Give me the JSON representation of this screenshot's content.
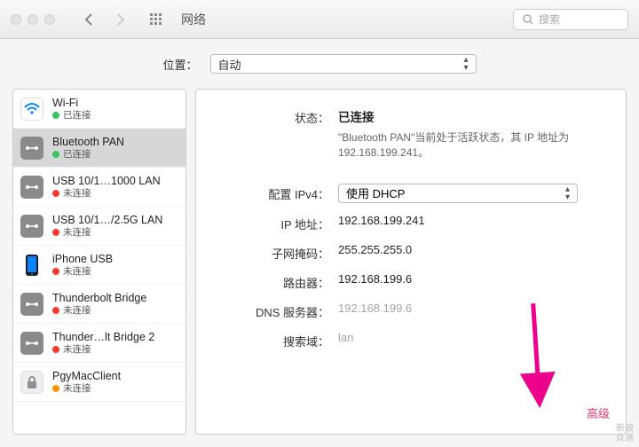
{
  "titlebar": {
    "title": "网络",
    "search_placeholder": "搜索"
  },
  "location": {
    "label": "位置：",
    "value": "自动"
  },
  "sidebar": {
    "items": [
      {
        "name": "Wi-Fi",
        "status": "已连接",
        "color": "green",
        "icon": "wifi"
      },
      {
        "name": "Bluetooth PAN",
        "status": "已连接",
        "color": "green",
        "icon": "eth"
      },
      {
        "name": "USB 10/1…1000 LAN",
        "status": "未连接",
        "color": "red",
        "icon": "eth"
      },
      {
        "name": "USB 10/1…/2.5G LAN",
        "status": "未连接",
        "color": "red",
        "icon": "eth"
      },
      {
        "name": "iPhone USB",
        "status": "未连接",
        "color": "red",
        "icon": "phone"
      },
      {
        "name": "Thunderbolt Bridge",
        "status": "未连接",
        "color": "red",
        "icon": "eth"
      },
      {
        "name": "Thunder…lt Bridge 2",
        "status": "未连接",
        "color": "red",
        "icon": "eth"
      },
      {
        "name": "PgyMacClient",
        "status": "未连接",
        "color": "orange",
        "icon": "lock"
      }
    ]
  },
  "detail": {
    "status_label": "状态：",
    "status_main": "已连接",
    "status_sub": "\"Bluetooth PAN\"当前处于活跃状态，其 IP 地址为 192.168.199.241。",
    "rows": [
      {
        "label": "配置 IPv4：",
        "value": "使用 DHCP",
        "type": "popup"
      },
      {
        "label": "IP 地址：",
        "value": "192.168.199.241"
      },
      {
        "label": "子网掩码：",
        "value": "255.255.255.0"
      },
      {
        "label": "路由器：",
        "value": "192.168.199.6"
      },
      {
        "label": "DNS 服务器：",
        "value": "192.168.199.6",
        "gray": true
      },
      {
        "label": "搜索域：",
        "value": "lan",
        "gray": true
      }
    ],
    "advanced": "高级"
  },
  "watermark": {
    "line1": "新浪",
    "line2": "众测"
  }
}
